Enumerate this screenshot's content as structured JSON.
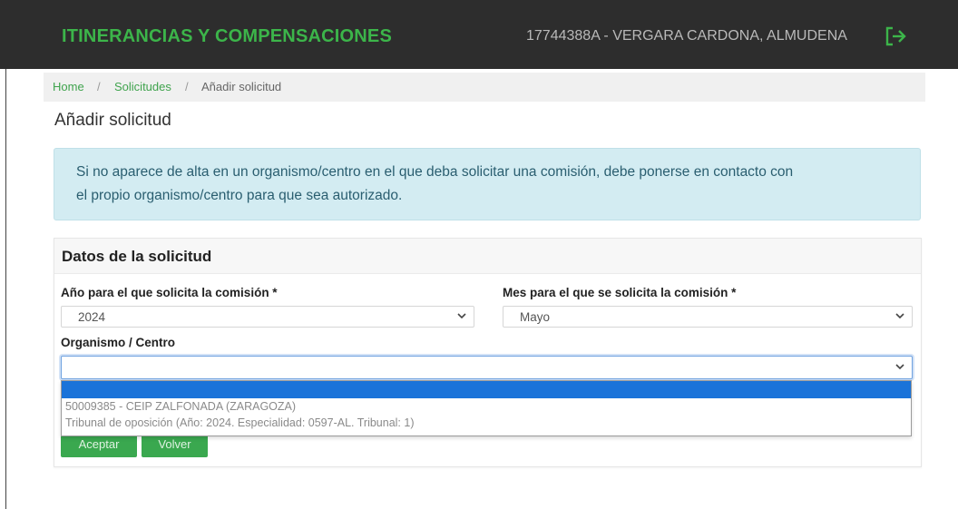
{
  "app": {
    "title": "ITINERANCIAS Y COMPENSACIONES",
    "user": "17744388A - VERGARA CARDONA, ALMUDENA",
    "logout_icon": "logout-icon"
  },
  "breadcrumb": [
    "Home",
    "Solicitudes",
    "Añadir solicitud"
  ],
  "breadcrumb_separator": "/",
  "page": {
    "title": "Añadir solicitud"
  },
  "alert": {
    "line1": "Si no aparece de alta en un organismo/centro en el que deba solicitar una comisión, debe ponerse en contacto con",
    "line2": "el propio organismo/centro para que sea autorizado."
  },
  "form": {
    "title": "Datos de la solicitud",
    "year": {
      "label": "Año para el que solicita la comisión *",
      "value": "2024"
    },
    "month": {
      "label": "Mes para el que se solicita la comisión *",
      "value": "Mayo"
    },
    "organismo": {
      "label": "Organismo / Centro",
      "value": "",
      "options": [
        "",
        "50009385 - CEIP ZALFONADA (ZARAGOZA)",
        "Tribunal de oposición (Año: 2024. Especialidad: 0597-AL. Tribunal: 1)"
      ]
    },
    "buttons": {
      "accept": "Aceptar",
      "back": "Volver"
    }
  },
  "colors": {
    "topbar": "#2d2d2d",
    "brand_green": "#3cb54a",
    "link_green": "#3fa34d",
    "alert_bg": "#d3ecf2",
    "highlight": "#1a73d9"
  }
}
